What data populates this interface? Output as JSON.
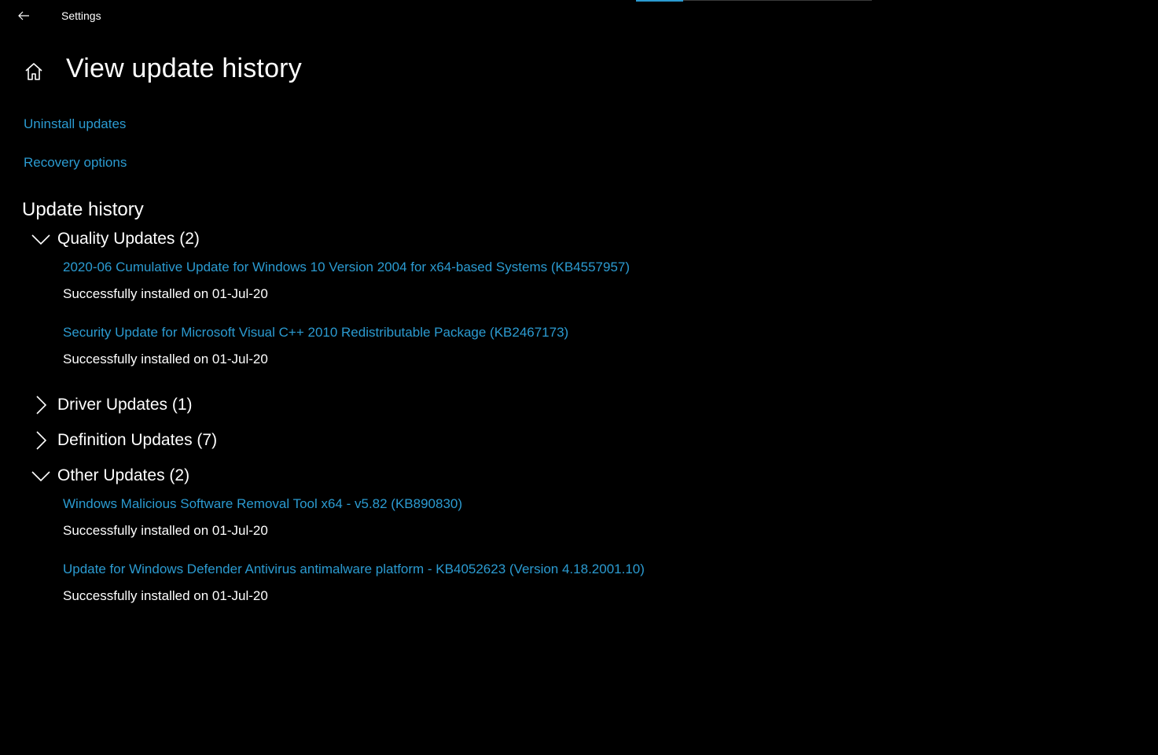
{
  "window": {
    "app_title": "Settings"
  },
  "header": {
    "title": "View update history"
  },
  "links": {
    "uninstall": "Uninstall updates",
    "recovery": "Recovery options"
  },
  "history": {
    "section_title": "Update history",
    "groups": [
      {
        "label": "Quality Updates (2)",
        "expanded": true,
        "items": [
          {
            "name": "2020-06 Cumulative Update for Windows 10 Version 2004 for x64-based Systems (KB4557957)",
            "status": "Successfully installed on 01-Jul-20"
          },
          {
            "name": "Security Update for Microsoft Visual C++ 2010 Redistributable Package (KB2467173)",
            "status": "Successfully installed on 01-Jul-20"
          }
        ]
      },
      {
        "label": "Driver Updates (1)",
        "expanded": false,
        "items": []
      },
      {
        "label": "Definition Updates (7)",
        "expanded": false,
        "items": []
      },
      {
        "label": "Other Updates (2)",
        "expanded": true,
        "items": [
          {
            "name": "Windows Malicious Software Removal Tool x64 - v5.82 (KB890830)",
            "status": "Successfully installed on 01-Jul-20"
          },
          {
            "name": "Update for Windows Defender Antivirus antimalware platform - KB4052623 (Version 4.18.2001.10)",
            "status": "Successfully installed on 01-Jul-20"
          }
        ]
      }
    ]
  },
  "icons": {
    "back": "back-arrow-icon",
    "home": "home-icon",
    "expanded": "chevron-down-icon",
    "collapsed": "chevron-right-icon"
  },
  "colors": {
    "background": "#000000",
    "accent_link": "#2b9bd1",
    "text": "#ffffff"
  }
}
